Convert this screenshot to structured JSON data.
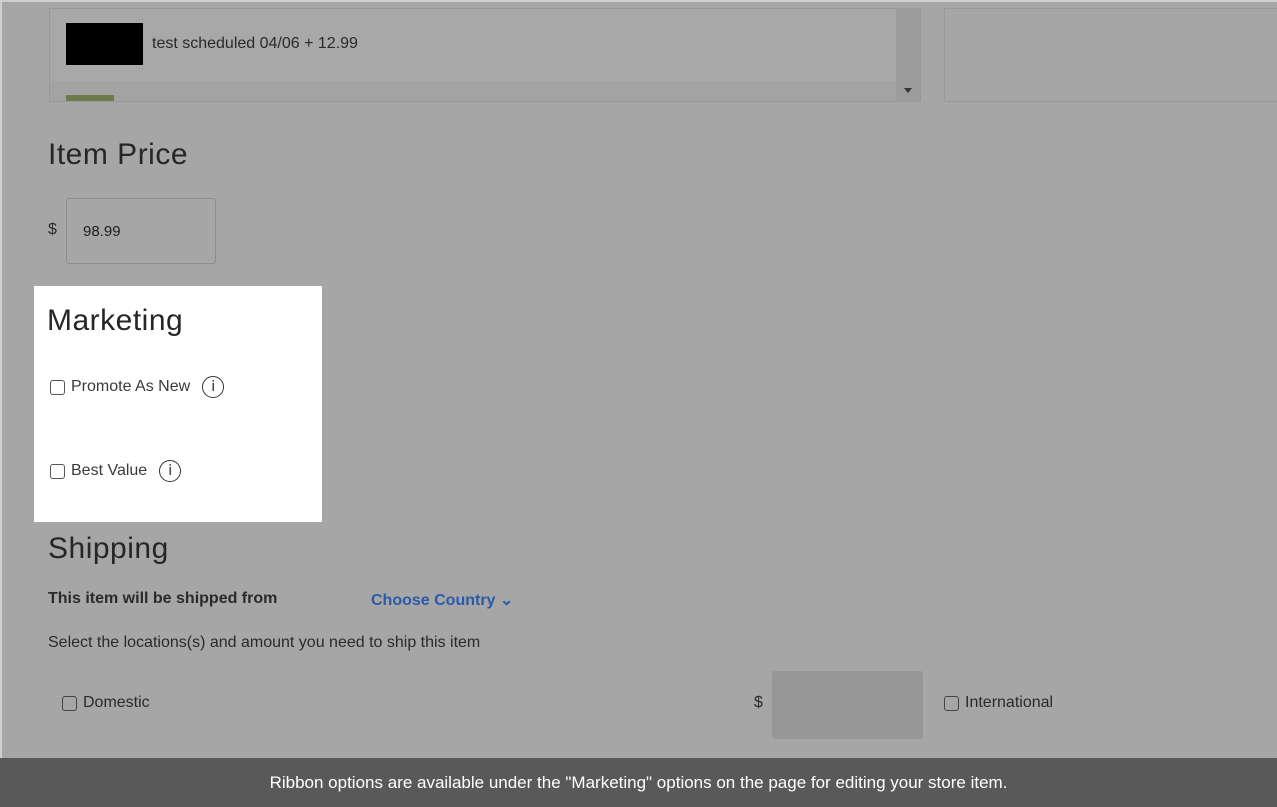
{
  "list": {
    "item_text": "test scheduled 04/06 + 12.99"
  },
  "price": {
    "heading": "Item Price",
    "currency": "$",
    "value": "98.99"
  },
  "marketing": {
    "heading": "Marketing",
    "options": [
      {
        "label": "Promote As New",
        "checked": false
      },
      {
        "label": "Best Value",
        "checked": false
      }
    ],
    "info_glyph": "i"
  },
  "shipping": {
    "heading": "Shipping",
    "ships_from_label": "This item will be shipped from",
    "choose_country": "Choose Country ⌄",
    "select_locations": "Select the locations(s) and amount you need to ship this item",
    "domestic_label": "Domestic",
    "currency": "$",
    "international_label": "International"
  },
  "caption": "Ribbon options are available under the \"Marketing\" options on the page for editing your store item.",
  "colors": {
    "overlay": "#a6a6a6",
    "link": "#2a5aa8",
    "caption_bg": "#595959"
  }
}
